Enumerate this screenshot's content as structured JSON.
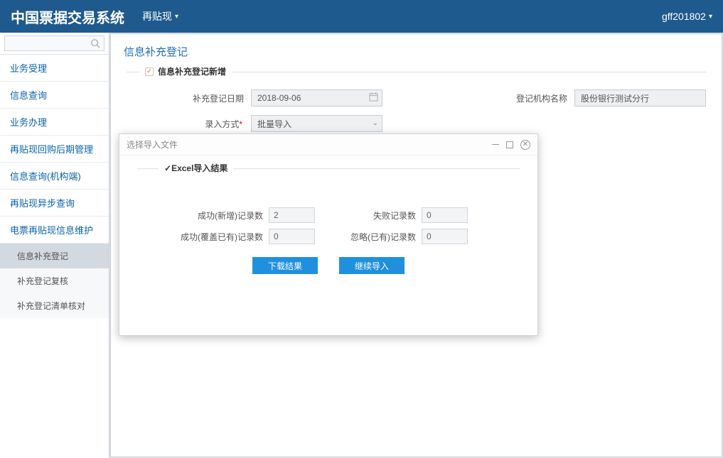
{
  "header": {
    "app_title": "中国票据交易系统",
    "menu_label": "再贴现",
    "user_label": "gff201802"
  },
  "sidebar": {
    "search_placeholder": "",
    "items": [
      {
        "label": "业务受理"
      },
      {
        "label": "信息查询"
      },
      {
        "label": "业务办理"
      },
      {
        "label": "再贴现回购后期管理"
      },
      {
        "label": "信息查询(机构端)"
      },
      {
        "label": "再贴现异步查询"
      },
      {
        "label": "电票再贴现信息维护"
      }
    ],
    "sub_items": [
      {
        "label": "信息补充登记",
        "active": true
      },
      {
        "label": "补充登记复核",
        "active": false
      },
      {
        "label": "补充登记清单核对",
        "active": false
      }
    ]
  },
  "main": {
    "page_title": "信息补充登记",
    "panel_title": "信息补充登记新增",
    "form": {
      "date_label": "补充登记日期",
      "date_value": "2018-09-06",
      "org_label": "登记机构名称",
      "org_value": "股份银行测试分行",
      "method_label": "录入方式",
      "method_value": "批量导入"
    }
  },
  "modal": {
    "title": "选择导入文件",
    "panel_title": "Excel导入结果",
    "results": {
      "success_new_label": "成功(新增)记录数",
      "success_new_value": "2",
      "fail_label": "失败记录数",
      "fail_value": "0",
      "success_over_label": "成功(覆盖已有)记录数",
      "success_over_value": "0",
      "ignore_label": "忽略(已有)记录数",
      "ignore_value": "0"
    },
    "buttons": {
      "download": "下载结果",
      "continue": "继续导入"
    }
  }
}
